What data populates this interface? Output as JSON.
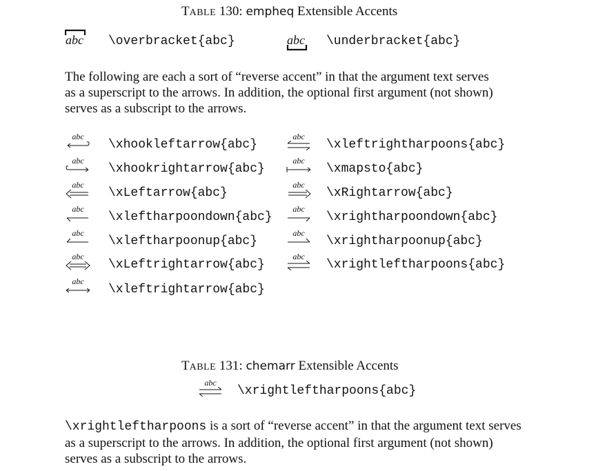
{
  "table130": {
    "caption_sc_first": "T",
    "caption_sc_rest": "ABLE",
    "caption_num": "130:",
    "caption_pkg": "empheq",
    "caption_rest": "Extensible Accents"
  },
  "brackets": {
    "sample": "abc",
    "over_cmd": "\\overbracket{abc}",
    "under_cmd": "\\underbracket{abc}"
  },
  "para1": {
    "line1": "The following are each a sort of “reverse accent” in that the argument text serves",
    "line2": "as a superscript to the arrows. In addition, the optional first argument (not shown)",
    "line3": "serves as a subscript to the arrows."
  },
  "arrow_label": "abc",
  "arrows_left": [
    {
      "icon": "xhookleftarrow-icon",
      "cmd": "\\xhookleftarrow{abc}"
    },
    {
      "icon": "xhookrightarrow-icon",
      "cmd": "\\xhookrightarrow{abc}"
    },
    {
      "icon": "xLeftarrow-icon",
      "cmd": "\\xLeftarrow{abc}"
    },
    {
      "icon": "xleftharpoondown-icon",
      "cmd": "\\xleftharpoondown{abc}"
    },
    {
      "icon": "xleftharpoonup-icon",
      "cmd": "\\xleftharpoonup{abc}"
    },
    {
      "icon": "xLeftrightarrow-icon",
      "cmd": "\\xLeftrightarrow{abc}"
    },
    {
      "icon": "xleftrightarrow-icon",
      "cmd": "\\xleftrightarrow{abc}"
    }
  ],
  "arrows_right": [
    {
      "icon": "xleftrightharpoons-icon",
      "cmd": "\\xleftrightharpoons{abc}"
    },
    {
      "icon": "xmapsto-icon",
      "cmd": "\\xmapsto{abc}"
    },
    {
      "icon": "xRightarrow-icon",
      "cmd": "\\xRightarrow{abc}"
    },
    {
      "icon": "xrightharpoondown-icon",
      "cmd": "\\xrightharpoondown{abc}"
    },
    {
      "icon": "xrightharpoonup-icon",
      "cmd": "\\xrightharpoonup{abc}"
    },
    {
      "icon": "xrightleftharpoons-icon",
      "cmd": "\\xrightleftharpoons{abc}"
    }
  ],
  "table131": {
    "caption_sc_first": "T",
    "caption_sc_rest": "ABLE",
    "caption_num": "131:",
    "caption_pkg": "chemarr",
    "caption_rest": "Extensible Accents",
    "cmd": "\\xrightleftharpoons{abc}"
  },
  "para2": {
    "cmd": "\\xrightleftharpoons",
    "line1_rest": " is a sort of “reverse accent” in that the argument text serves",
    "line2": "as a superscript to the arrows. In addition, the optional first argument (not shown)",
    "line3": "serves as a subscript to the arrows."
  }
}
